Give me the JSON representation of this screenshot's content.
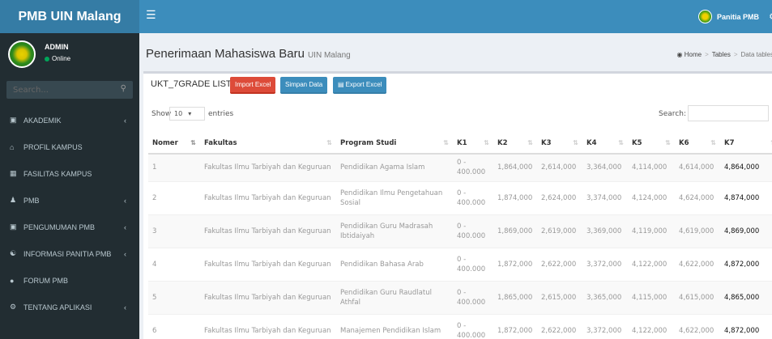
{
  "app": {
    "brand": "PMB UIN Malang",
    "nav_user": "Panitia PMB"
  },
  "sidebar": {
    "user_name": "ADMIN",
    "user_status": "Online",
    "search_placeholder": "Search...",
    "items": [
      {
        "label": "AKADEMIK",
        "has_children": true
      },
      {
        "label": "PROFIL KAMPUS",
        "has_children": false
      },
      {
        "label": "FASILITAS KAMPUS",
        "has_children": false
      },
      {
        "label": "PMB",
        "has_children": true
      },
      {
        "label": "PENGUMUMAN PMB",
        "has_children": true
      },
      {
        "label": "INFORMASI PANITIA PMB",
        "has_children": true
      },
      {
        "label": "FORUM PMB",
        "has_children": false
      },
      {
        "label": "TENTANG APLIKASI",
        "has_children": true
      }
    ]
  },
  "header": {
    "title": "Penerimaan Mahasiswa Baru",
    "subtitle": "UIN Malang"
  },
  "breadcrumb": {
    "home": "Home",
    "tables": "Tables",
    "current": "Data tables"
  },
  "box": {
    "title": "UKT_7GRADE LIST",
    "import_label": "Import Excel",
    "simpan_label": "Simpan Data",
    "export_label": "Export Excel"
  },
  "datatable": {
    "show_label": "Show",
    "length_value": "10",
    "entries_label": "entries",
    "search_label": "Search:"
  },
  "table": {
    "headers": [
      "Nomer",
      "Fakultas",
      "Program Studi",
      "K1",
      "K2",
      "K3",
      "K4",
      "K5",
      "K6",
      "K7"
    ],
    "rows": [
      [
        "1",
        "Fakultas Ilmu Tarbiyah dan Keguruan",
        "Pendidikan Agama Islam",
        "0 - 400.000",
        "1,864,000",
        "2,614,000",
        "3,364,000",
        "4,114,000",
        "4,614,000",
        "4,864,000"
      ],
      [
        "2",
        "Fakultas Ilmu Tarbiyah dan Keguruan",
        "Pendidikan Ilmu Pengetahuan Sosial",
        "0 - 400.000",
        "1,874,000",
        "2,624,000",
        "3,374,000",
        "4,124,000",
        "4,624,000",
        "4,874,000"
      ],
      [
        "3",
        "Fakultas Ilmu Tarbiyah dan Keguruan",
        "Pendidikan Guru Madrasah Ibtidaiyah",
        "0 - 400.000",
        "1,869,000",
        "2,619,000",
        "3,369,000",
        "4,119,000",
        "4,619,000",
        "4,869,000"
      ],
      [
        "4",
        "Fakultas Ilmu Tarbiyah dan Keguruan",
        "Pendidikan Bahasa Arab",
        "0 - 400.000",
        "1,872,000",
        "2,622,000",
        "3,372,000",
        "4,122,000",
        "4,622,000",
        "4,872,000"
      ],
      [
        "5",
        "Fakultas Ilmu Tarbiyah dan Keguruan",
        "Pendidikan Guru Raudlatul Athfal",
        "0 - 400.000",
        "1,865,000",
        "2,615,000",
        "3,365,000",
        "4,115,000",
        "4,615,000",
        "4,865,000"
      ],
      [
        "6",
        "Fakultas Ilmu Tarbiyah dan Keguruan",
        "Manajemen Pendidikan Islam",
        "0 - 400.000",
        "1,872,000",
        "2,622,000",
        "3,372,000",
        "4,122,000",
        "4,622,000",
        "4,872,000"
      ]
    ]
  },
  "colors": {
    "header": "#3c8dbc",
    "logo": "#357ca5",
    "sidebar": "#222d32",
    "danger": "#dd4b39",
    "online": "#00a65a"
  }
}
